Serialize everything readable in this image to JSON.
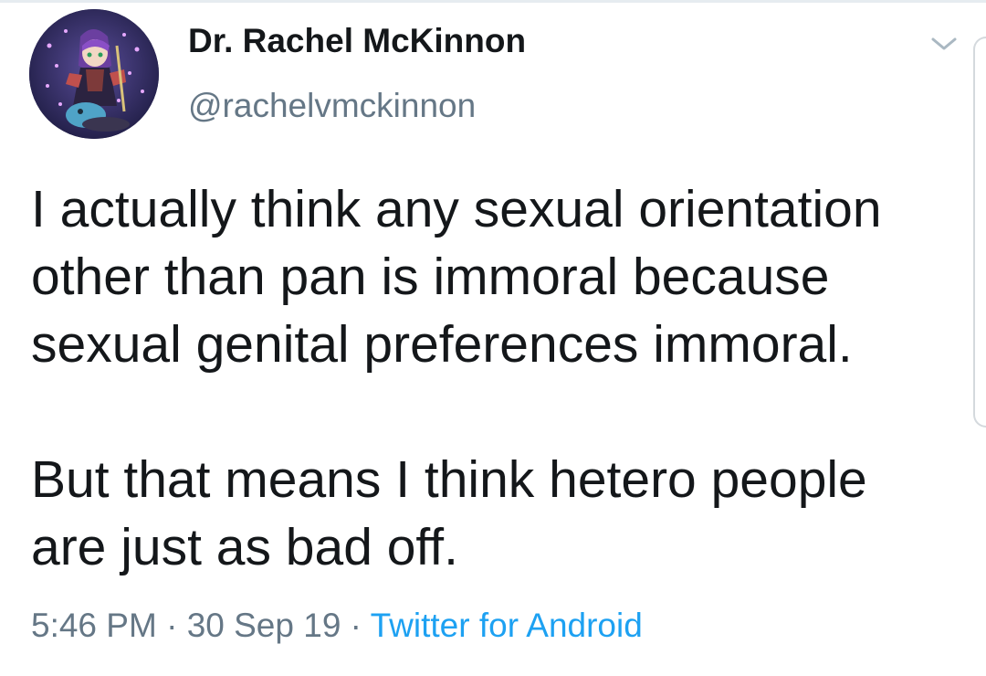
{
  "tweet": {
    "author": {
      "display_name": "Dr. Rachel McKinnon",
      "handle": "@rachelvmckinnon",
      "avatar_icon": "profile-avatar"
    },
    "text_paragraphs": [
      [
        "I actually think any sexual orientation",
        "other than pan is immoral because",
        "sexual genital preferences immoral."
      ],
      [
        "But that means I think hetero people",
        "are just as bad off."
      ]
    ],
    "timestamp": {
      "time": "5:46 PM",
      "separator": " · ",
      "date": "30 Sep 19",
      "source": "Twitter for Android"
    },
    "menu_icon": "chevron-down-icon"
  },
  "colors": {
    "text": "#14171a",
    "secondary_text": "#657786",
    "link": "#1da1f2"
  }
}
